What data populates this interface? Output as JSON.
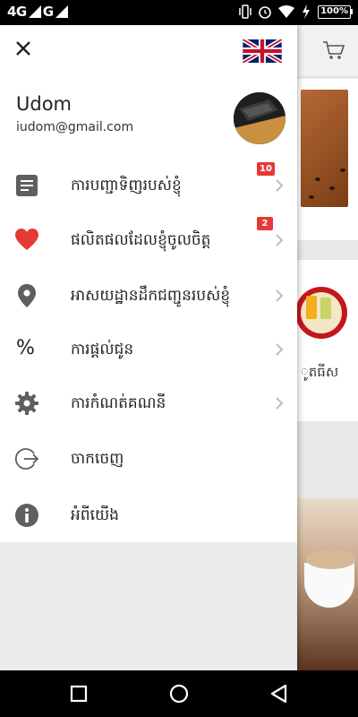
{
  "status_bar": {
    "network": "4G",
    "network2": "G",
    "battery": "100%"
  },
  "drawer": {
    "user": {
      "name": "Udom",
      "email": "iudom@gmail.com"
    },
    "language_flag": "uk-flag-icon",
    "menu": [
      {
        "label": "ការបញ្ជាទិញរបស់ខ្ញុំ",
        "icon": "document-icon",
        "badge": "10",
        "chevron": true
      },
      {
        "label": "ផលិតផលដែលខ្ញុំចូលចិត្ត",
        "icon": "heart-icon",
        "badge": "2",
        "chevron": true
      },
      {
        "label": "អាសយដ្ឋានដឹកជញ្ជូនរបស់ខ្ញុំ",
        "icon": "location-pin-icon",
        "badge": "",
        "chevron": true
      },
      {
        "label": "ការផ្តល់ជូន",
        "icon": "percent-icon",
        "badge": "",
        "chevron": true
      },
      {
        "label": "ការកំណត់គណនី",
        "icon": "gear-icon",
        "badge": "",
        "chevron": true
      },
      {
        "label": "ចាកចេញ",
        "icon": "logout-icon",
        "badge": "",
        "chevron": false
      },
      {
        "label": "អំពីយើង",
        "icon": "info-icon",
        "badge": "",
        "chevron": false
      }
    ]
  },
  "background": {
    "visible_label": "ូតធីស"
  },
  "colors": {
    "heart": "#e53935",
    "badge": "#e53935",
    "icon_gray": "#5f5f5f"
  }
}
